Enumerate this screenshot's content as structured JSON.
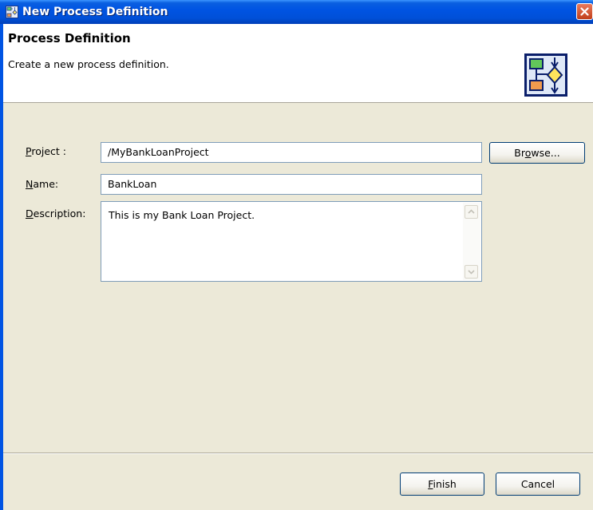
{
  "window": {
    "title": "New Process Definition"
  },
  "header": {
    "title": "Process Definition",
    "description": "Create a new process definition."
  },
  "form": {
    "project": {
      "label_prefix": "",
      "label_mnemonic": "P",
      "label_rest": "roject :",
      "value": "/MyBankLoanProject"
    },
    "name": {
      "label_mnemonic": "N",
      "label_rest": "ame:",
      "value": "BankLoan"
    },
    "description": {
      "label_mnemonic": "D",
      "label_rest": "escription:",
      "value": "This is my Bank Loan Project."
    },
    "browse_button": {
      "label_before": "Br",
      "label_mnemonic": "o",
      "label_after": "wse..."
    }
  },
  "footer": {
    "finish_button": {
      "label_mnemonic": "F",
      "label_rest": "inish"
    },
    "cancel_button": {
      "label": "Cancel"
    }
  },
  "colors": {
    "titlebar": "#0054e3",
    "dialog_bg": "#ece9d8",
    "field_border": "#7f9db9",
    "close_button": "#c13f1a"
  },
  "icons": {
    "title_icon": "process-definition-icon",
    "header_icon": "process-flow-wizard-icon",
    "close_icon": "close-icon"
  }
}
